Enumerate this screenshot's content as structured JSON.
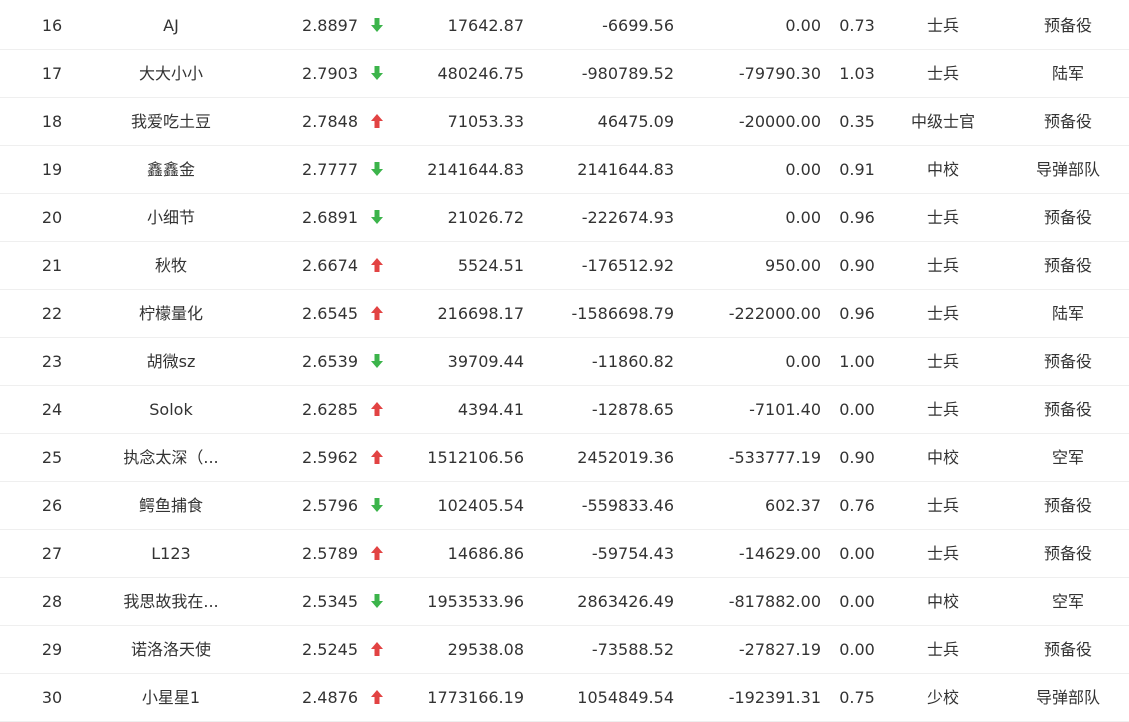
{
  "colors": {
    "up": "#e24343",
    "down": "#3cb44b"
  },
  "rows": [
    {
      "rank": "16",
      "name": "AJ",
      "score": "2.8897",
      "trend": "down",
      "v1": "17642.87",
      "v2": "-6699.56",
      "v3": "0.00",
      "ratio": "0.73",
      "title": "士兵",
      "branch": "预备役"
    },
    {
      "rank": "17",
      "name": "大大小小",
      "score": "2.7903",
      "trend": "down",
      "v1": "480246.75",
      "v2": "-980789.52",
      "v3": "-79790.30",
      "ratio": "1.03",
      "title": "士兵",
      "branch": "陆军"
    },
    {
      "rank": "18",
      "name": "我爱吃土豆",
      "score": "2.7848",
      "trend": "up",
      "v1": "71053.33",
      "v2": "46475.09",
      "v3": "-20000.00",
      "ratio": "0.35",
      "title": "中级士官",
      "branch": "预备役"
    },
    {
      "rank": "19",
      "name": "鑫鑫金",
      "score": "2.7777",
      "trend": "down",
      "v1": "2141644.83",
      "v2": "2141644.83",
      "v3": "0.00",
      "ratio": "0.91",
      "title": "中校",
      "branch": "导弹部队"
    },
    {
      "rank": "20",
      "name": "小细节",
      "score": "2.6891",
      "trend": "down",
      "v1": "21026.72",
      "v2": "-222674.93",
      "v3": "0.00",
      "ratio": "0.96",
      "title": "士兵",
      "branch": "预备役"
    },
    {
      "rank": "21",
      "name": "秋牧",
      "score": "2.6674",
      "trend": "up",
      "v1": "5524.51",
      "v2": "-176512.92",
      "v3": "950.00",
      "ratio": "0.90",
      "title": "士兵",
      "branch": "预备役"
    },
    {
      "rank": "22",
      "name": "柠檬量化",
      "score": "2.6545",
      "trend": "up",
      "v1": "216698.17",
      "v2": "-1586698.79",
      "v3": "-222000.00",
      "ratio": "0.96",
      "title": "士兵",
      "branch": "陆军"
    },
    {
      "rank": "23",
      "name": "胡微sz",
      "score": "2.6539",
      "trend": "down",
      "v1": "39709.44",
      "v2": "-11860.82",
      "v3": "0.00",
      "ratio": "1.00",
      "title": "士兵",
      "branch": "预备役"
    },
    {
      "rank": "24",
      "name": "Solok",
      "score": "2.6285",
      "trend": "up",
      "v1": "4394.41",
      "v2": "-12878.65",
      "v3": "-7101.40",
      "ratio": "0.00",
      "title": "士兵",
      "branch": "预备役"
    },
    {
      "rank": "25",
      "name": "执念太深（...",
      "score": "2.5962",
      "trend": "up",
      "v1": "1512106.56",
      "v2": "2452019.36",
      "v3": "-533777.19",
      "ratio": "0.90",
      "title": "中校",
      "branch": "空军"
    },
    {
      "rank": "26",
      "name": "鳄鱼捕食",
      "score": "2.5796",
      "trend": "down",
      "v1": "102405.54",
      "v2": "-559833.46",
      "v3": "602.37",
      "ratio": "0.76",
      "title": "士兵",
      "branch": "预备役"
    },
    {
      "rank": "27",
      "name": "L123",
      "score": "2.5789",
      "trend": "up",
      "v1": "14686.86",
      "v2": "-59754.43",
      "v3": "-14629.00",
      "ratio": "0.00",
      "title": "士兵",
      "branch": "预备役"
    },
    {
      "rank": "28",
      "name": "我思故我在...",
      "score": "2.5345",
      "trend": "down",
      "v1": "1953533.96",
      "v2": "2863426.49",
      "v3": "-817882.00",
      "ratio": "0.00",
      "title": "中校",
      "branch": "空军"
    },
    {
      "rank": "29",
      "name": "诺洛洛天使",
      "score": "2.5245",
      "trend": "up",
      "v1": "29538.08",
      "v2": "-73588.52",
      "v3": "-27827.19",
      "ratio": "0.00",
      "title": "士兵",
      "branch": "预备役"
    },
    {
      "rank": "30",
      "name": "小星星1",
      "score": "2.4876",
      "trend": "up",
      "v1": "1773166.19",
      "v2": "1054849.54",
      "v3": "-192391.31",
      "ratio": "0.75",
      "title": "少校",
      "branch": "导弹部队"
    }
  ]
}
